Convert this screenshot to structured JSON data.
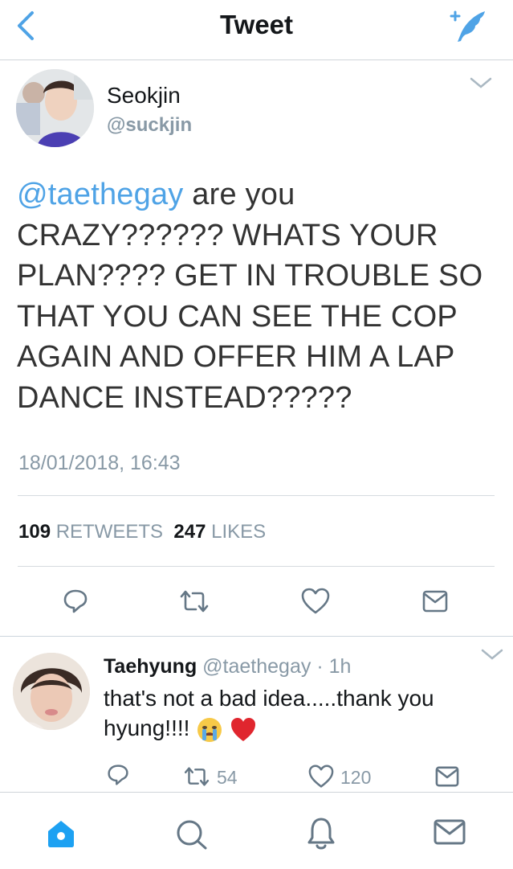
{
  "nav": {
    "title": "Tweet",
    "back_icon": "chevron-left-icon",
    "compose_icon": "compose-feather-icon",
    "accent": "#4fa3e6"
  },
  "tweet": {
    "author_name": "Seokjin",
    "author_handle": "@suckjin",
    "mention": "@taethegay",
    "text": " are you CRAZY?????? WHATS YOUR PLAN???? GET IN TROUBLE SO THAT YOU CAN SEE THE COP AGAIN AND OFFER HIM A LAP DANCE INSTEAD?????",
    "timestamp": "18/01/2018, 16:43",
    "retweets_count": "109",
    "retweets_label": "RETWEETS",
    "likes_count": "247",
    "likes_label": "LIKES"
  },
  "reply": {
    "author_name": "Taehyung",
    "author_handle": "@taethegay",
    "separator": "·",
    "time": "1h",
    "text": "that's not a bad idea.....thank you hyung!!!!",
    "emojis": [
      "crying-face",
      "red-heart"
    ],
    "retweets": "54",
    "likes": "120"
  },
  "tabbar": {
    "items": [
      "home-icon",
      "search-icon",
      "notifications-icon",
      "messages-icon"
    ]
  }
}
